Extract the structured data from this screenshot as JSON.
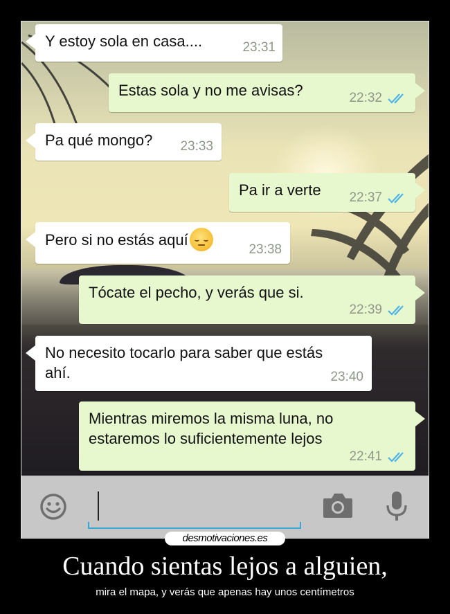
{
  "messages": [
    {
      "direction": "incoming",
      "text": "Y estoy sola en casa....",
      "time": "23:31"
    },
    {
      "direction": "outgoing",
      "text": "Estas sola y no me avisas?",
      "time": "22:32",
      "status": "read-double-check"
    },
    {
      "direction": "incoming",
      "text": "Pa qué mongo?",
      "time": "23:33"
    },
    {
      "direction": "outgoing",
      "text": "Pa ir a verte",
      "time": "22:37",
      "status": "read-double-check"
    },
    {
      "direction": "incoming",
      "text": "Pero si no estás aquí",
      "emoji": "pensive-face-emoji",
      "time": "23:38"
    },
    {
      "direction": "outgoing",
      "text": "Tócate el pecho, y verás que si.",
      "time": "22:39",
      "status": "read-double-check"
    },
    {
      "direction": "incoming",
      "text": "No necesito tocarlo para saber que estás ahí.",
      "time": "23:40"
    },
    {
      "direction": "outgoing",
      "text": "Mientras miremos la misma luna, no estaremos lo suficientemente lejos",
      "time": "22:41",
      "status": "read-double-check"
    }
  ],
  "input_bar": {
    "text_value": "",
    "icons": [
      "smiley-icon",
      "camera-icon",
      "microphone-icon"
    ]
  },
  "watermark": "desmotivaciones.es",
  "caption": {
    "title": "Cuando sientas lejos a alguien,",
    "subtitle": "mira el mapa, y verás que apenas hay unos centímetros"
  },
  "colors": {
    "incoming_bubble": "#ffffff",
    "outgoing_bubble": "#e7f8cf",
    "timestamp": "#8f9688",
    "read_ticks": "#4fb3e8",
    "input_underline": "#38a6d8",
    "input_bar": "#c7c7c7",
    "poster_background": "#000000"
  }
}
